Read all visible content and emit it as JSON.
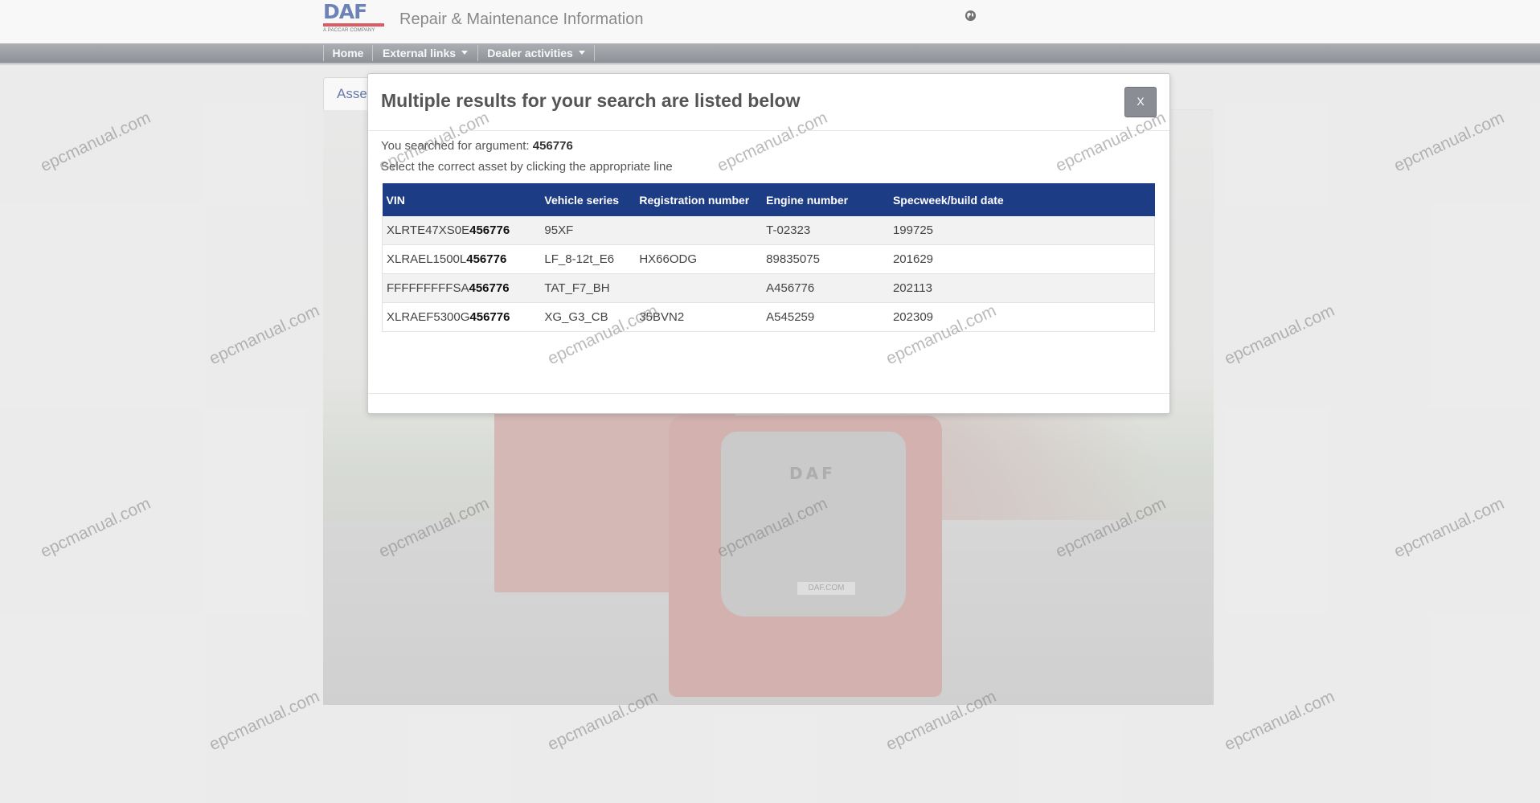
{
  "header": {
    "logo_text": "DAF",
    "logo_subtext": "A PACCAR COMPANY",
    "title": "Repair & Maintenance Information"
  },
  "nav": [
    {
      "label": "Home"
    },
    {
      "label": "External links"
    },
    {
      "label": "Dealer activities"
    }
  ],
  "page": {
    "tab_label": "Asse",
    "hero_logo": "DAF",
    "hero_plate": "DAF.COM"
  },
  "modal": {
    "title": "Multiple results for your search are listed below",
    "close_label": "X",
    "search_prefix": "You searched for argument: ",
    "search_argument": "456776",
    "hint": "Select the correct asset by clicking the appropriate line",
    "columns": [
      "VIN",
      "Vehicle series",
      "Registration number",
      "Engine number",
      "Specweek/build date"
    ],
    "rows": [
      {
        "vin_prefix": "XLRTE47XS0E",
        "vin_match": "456776",
        "series": "95XF",
        "registration": "",
        "engine": "T-02323",
        "specweek": "199725"
      },
      {
        "vin_prefix": "XLRAEL1500L",
        "vin_match": "456776",
        "series": "LF_8-12t_E6",
        "registration": "HX66ODG",
        "engine": "89835075",
        "specweek": "201629"
      },
      {
        "vin_prefix": "FFFFFFFFFSA",
        "vin_match": "456776",
        "series": "TAT_F7_BH",
        "registration": "",
        "engine": "A456776",
        "specweek": "202113"
      },
      {
        "vin_prefix": "XLRAEF5300G",
        "vin_match": "456776",
        "series": "XG_G3_CB",
        "registration": "35BVN2",
        "engine": "A545259",
        "specweek": "202309"
      }
    ]
  },
  "watermark": "epcmanual.com",
  "colors": {
    "brand_blue": "#1d3c86",
    "logo_red": "#d0101b",
    "nav_gray": "#6e747b"
  }
}
